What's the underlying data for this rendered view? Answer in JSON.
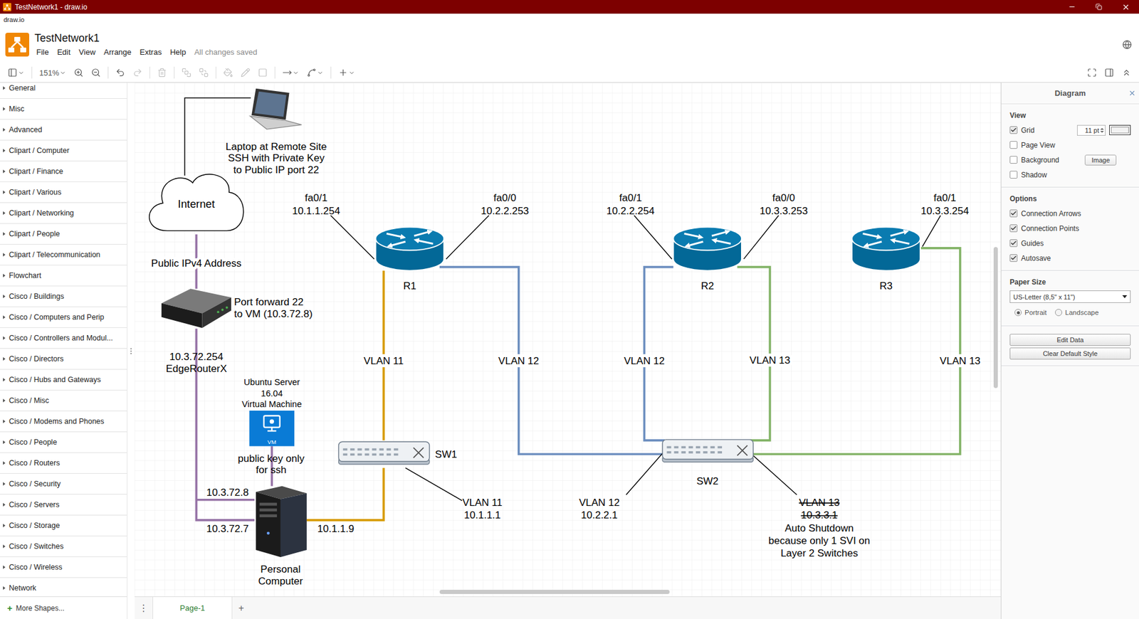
{
  "window": {
    "title": "TestNetwork1 - draw.io",
    "subtitle": "draw.io"
  },
  "header": {
    "title": "TestNetwork1",
    "menu": [
      "File",
      "Edit",
      "View",
      "Arrange",
      "Extras",
      "Help"
    ],
    "status": "All changes saved"
  },
  "toolbar": {
    "items": [
      {
        "kind": "panels",
        "dropdown": true,
        "disabled": false
      },
      {
        "kind": "zoom",
        "text": "151%",
        "dropdown": true,
        "disabled": false
      },
      {
        "kind": "zoom-in",
        "dropdown": false,
        "disabled": false
      },
      {
        "kind": "zoom-out",
        "dropdown": false,
        "disabled": false
      },
      {
        "kind": "undo",
        "dropdown": false,
        "disabled": false
      },
      {
        "kind": "redo",
        "dropdown": false,
        "disabled": true
      },
      {
        "kind": "delete",
        "dropdown": false,
        "disabled": true
      },
      {
        "kind": "to-front",
        "dropdown": false,
        "disabled": true
      },
      {
        "kind": "to-back",
        "dropdown": false,
        "disabled": true
      },
      {
        "kind": "fill",
        "dropdown": false,
        "disabled": true
      },
      {
        "kind": "line",
        "dropdown": false,
        "disabled": true
      },
      {
        "kind": "shadow",
        "dropdown": false,
        "disabled": true
      },
      {
        "kind": "connection",
        "dropdown": true,
        "disabled": false
      },
      {
        "kind": "waypoints",
        "dropdown": true,
        "disabled": false
      },
      {
        "kind": "insert",
        "dropdown": true,
        "disabled": false
      }
    ],
    "right": [
      {
        "kind": "fullscreen",
        "dropdown": false,
        "disabled": false
      },
      {
        "kind": "format-panel",
        "dropdown": false,
        "disabled": false
      },
      {
        "kind": "collapse",
        "dropdown": false,
        "disabled": false
      }
    ]
  },
  "sidebar": {
    "items": [
      {
        "label": "General",
        "expanded": false
      },
      {
        "label": "Misc",
        "expanded": false
      },
      {
        "label": "Advanced",
        "expanded": false
      },
      {
        "label": "Clipart / Computer",
        "expanded": false
      },
      {
        "label": "Clipart / Finance",
        "expanded": false
      },
      {
        "label": "Clipart / Various",
        "expanded": false
      },
      {
        "label": "Clipart / Networking",
        "expanded": false
      },
      {
        "label": "Clipart / People",
        "expanded": false
      },
      {
        "label": "Clipart / Telecommunication",
        "expanded": false
      },
      {
        "label": "Flowchart",
        "expanded": false
      },
      {
        "label": "Cisco / Buildings",
        "expanded": false
      },
      {
        "label": "Cisco / Computers and Perip",
        "expanded": false
      },
      {
        "label": "Cisco / Controllers and Modul...",
        "expanded": false
      },
      {
        "label": "Cisco / Directors",
        "expanded": false
      },
      {
        "label": "Cisco / Hubs and Gateways",
        "expanded": false
      },
      {
        "label": "Cisco / Misc",
        "expanded": false
      },
      {
        "label": "Cisco / Modems and Phones",
        "expanded": false
      },
      {
        "label": "Cisco / People",
        "expanded": false
      },
      {
        "label": "Cisco / Routers",
        "expanded": false
      },
      {
        "label": "Cisco / Security",
        "expanded": false
      },
      {
        "label": "Cisco / Servers",
        "expanded": false
      },
      {
        "label": "Cisco / Storage",
        "expanded": false
      },
      {
        "label": "Cisco / Switches",
        "expanded": false
      },
      {
        "label": "Cisco / Wireless",
        "expanded": false
      },
      {
        "label": "Network",
        "expanded": false
      }
    ],
    "footer": {
      "icon": "+",
      "label": "More Shapes..."
    }
  },
  "diagram": {
    "nodes": [
      {
        "kind": "laptop",
        "label": [
          "Laptop at Remote Site",
          "SSH with Private Key",
          "to Public IP port 22"
        ]
      },
      {
        "kind": "cloud",
        "label": [
          "Internet"
        ]
      },
      {
        "kind": "edge-router",
        "label": [
          "10.3.72.254",
          "EdgeRouterX"
        ]
      },
      {
        "kind": "vm",
        "badge": "VM",
        "caption": [
          "Ubuntu Server",
          "16.04",
          "Virtual Machine"
        ],
        "label": [
          "public key only",
          "for ssh"
        ]
      },
      {
        "kind": "pc",
        "label": [
          "Personal",
          "Computer"
        ]
      },
      {
        "kind": "router",
        "label": [
          "R1"
        ]
      },
      {
        "kind": "router",
        "label": [
          "R2"
        ]
      },
      {
        "kind": "router",
        "label": [
          "R3"
        ]
      },
      {
        "kind": "switch",
        "label": [
          "SW1"
        ]
      },
      {
        "kind": "switch",
        "label": [
          "SW2"
        ]
      }
    ],
    "links": [
      {
        "color": "#000000"
      },
      {
        "color": "#9673a6",
        "label": "Public IPv4 Address"
      },
      {
        "color": "#9673a6"
      },
      {
        "color": "#9673a6"
      },
      {
        "color": "#9673a6"
      },
      {
        "color": "#d79b00"
      },
      {
        "color": "#d79b00",
        "label": "VLAN 11"
      },
      {
        "color": "#6c8ebf",
        "label": "VLAN 12"
      },
      {
        "color": "#6c8ebf",
        "label": "VLAN 12"
      },
      {
        "color": "#82b366",
        "label": "VLAN 13"
      },
      {
        "color": "#82b366",
        "label": "VLAN 13"
      }
    ],
    "notes": [
      {
        "lines": [
          {
            "text": "Port forward 22",
            "struck": false
          },
          {
            "text": "to VM (10.3.72.8)",
            "struck": false
          }
        ]
      },
      {
        "lines": [
          {
            "text": "10.3.72.8",
            "struck": false
          }
        ]
      },
      {
        "lines": [
          {
            "text": "10.3.72.7",
            "struck": false
          }
        ]
      },
      {
        "lines": [
          {
            "text": "10.1.1.9",
            "struck": false
          }
        ]
      },
      {
        "lines": [
          {
            "text": "fa0/1",
            "struck": false
          },
          {
            "text": "10.1.1.254",
            "struck": false
          }
        ]
      },
      {
        "lines": [
          {
            "text": "fa0/0",
            "struck": false
          },
          {
            "text": "10.2.2.253",
            "struck": false
          }
        ]
      },
      {
        "lines": [
          {
            "text": "fa0/1",
            "struck": false
          },
          {
            "text": "10.2.2.254",
            "struck": false
          }
        ]
      },
      {
        "lines": [
          {
            "text": "fa0/0",
            "struck": false
          },
          {
            "text": "10.3.3.253",
            "struck": false
          }
        ]
      },
      {
        "lines": [
          {
            "text": "fa0/1",
            "struck": false
          },
          {
            "text": "10.3.3.254",
            "struck": false
          }
        ]
      },
      {
        "lines": [
          {
            "text": "VLAN 11",
            "struck": false
          },
          {
            "text": "10.1.1.1",
            "struck": false
          }
        ]
      },
      {
        "lines": [
          {
            "text": "VLAN 12",
            "struck": false
          },
          {
            "text": "10.2.2.1",
            "struck": false
          }
        ]
      },
      {
        "lines": [
          {
            "text": "VLAN 13",
            "struck": true
          },
          {
            "text": "10.3.3.1",
            "struck": true
          },
          {
            "text": "Auto Shutdown",
            "struck": false
          },
          {
            "text": "because only 1 SVI on",
            "struck": false
          },
          {
            "text": "Layer 2 Switches",
            "struck": false
          }
        ]
      }
    ]
  },
  "pages": {
    "menu": "⋮",
    "tabs": [
      {
        "label": "Page-1",
        "selected": true
      }
    ],
    "add": "+"
  },
  "format": {
    "title": "Diagram",
    "sections": [
      {
        "title": "View",
        "rows": [
          {
            "kind": "checkbox",
            "label": "Grid",
            "checked": true,
            "input": "11 pt"
          },
          {
            "kind": "checkbox",
            "label": "Page View",
            "checked": false
          },
          {
            "kind": "checkbox",
            "label": "Background",
            "checked": false,
            "button": "Image"
          },
          {
            "kind": "checkbox",
            "label": "Shadow",
            "checked": false
          }
        ]
      },
      {
        "title": "Options",
        "rows": [
          {
            "kind": "checkbox",
            "label": "Connection Arrows",
            "checked": true
          },
          {
            "kind": "checkbox",
            "label": "Connection Points",
            "checked": true
          },
          {
            "kind": "checkbox",
            "label": "Guides",
            "checked": true
          },
          {
            "kind": "checkbox",
            "label": "Autosave",
            "checked": true
          }
        ]
      },
      {
        "title": "Paper Size",
        "rows": [
          {
            "kind": "select",
            "value": "US-Letter (8,5\" x 11\")"
          },
          {
            "kind": "radios",
            "options": [
              {
                "label": "Portrait",
                "selected": true
              },
              {
                "label": "Landscape",
                "selected": false
              }
            ]
          }
        ]
      },
      {
        "rows": [
          {
            "kind": "button",
            "label": "Edit Data"
          },
          {
            "kind": "button",
            "label": "Clear Default Style"
          }
        ]
      }
    ]
  }
}
